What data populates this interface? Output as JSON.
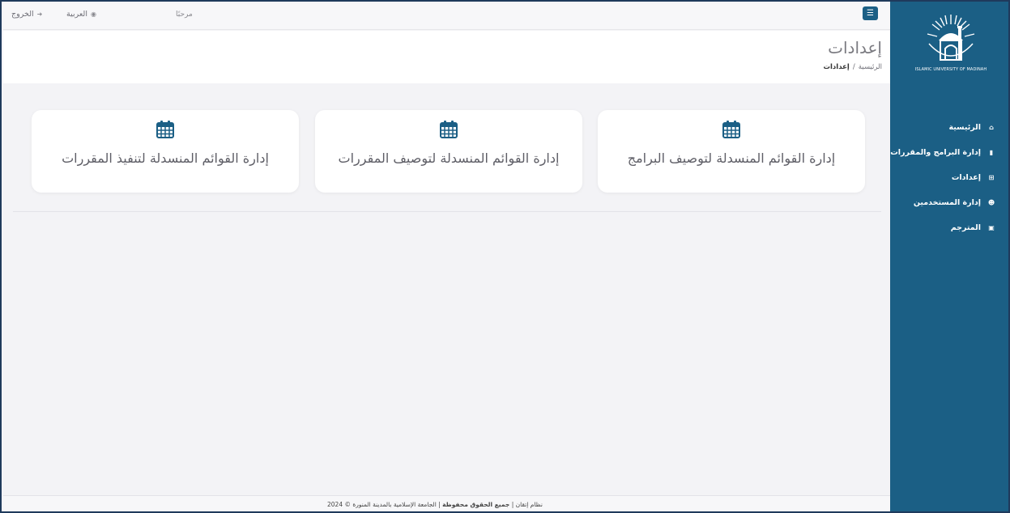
{
  "topbar": {
    "menu_icon": "hamburger-icon",
    "welcome": "مرحبًا",
    "language": "العربية",
    "language_icon": "globe-icon",
    "logout": "الخروج",
    "logout_icon": "sign-out-icon"
  },
  "sidebar": {
    "logo_caption": "ISLAMIC UNIVERSITY OF MADINAH",
    "items": [
      {
        "label": "الرئيسية",
        "icon": "home-icon"
      },
      {
        "label": "إدارة البرامج والمقررات",
        "icon": "book-icon"
      },
      {
        "label": "إعدادات",
        "icon": "table-icon"
      },
      {
        "label": "إدارة المستخدمين",
        "icon": "users-icon"
      },
      {
        "label": "المترجم",
        "icon": "language-icon"
      }
    ]
  },
  "page": {
    "title": "إعدادات",
    "breadcrumb": {
      "home": "الرئيسية",
      "separator": "/",
      "current": "إعدادات"
    }
  },
  "cards": [
    {
      "label": "إدارة القوائم المنسدلة لتوصيف البرامج",
      "icon": "calendar-icon"
    },
    {
      "label": "إدارة القوائم المنسدلة لتوصيف المقررات",
      "icon": "calendar-icon"
    },
    {
      "label": "إدارة القوائم المنسدلة لتنفيذ المقررات",
      "icon": "calendar-icon"
    }
  ],
  "footer": {
    "system": "نظام إتقان |",
    "rights": "جميع الحقوق محفوظة",
    "org": "| الجامعة الإسلامية بالمدينة المنورة © 2024"
  },
  "colors": {
    "sidebar": "#1b5f85",
    "frame_border": "#1f3a5c",
    "background": "#f3f3f6"
  }
}
